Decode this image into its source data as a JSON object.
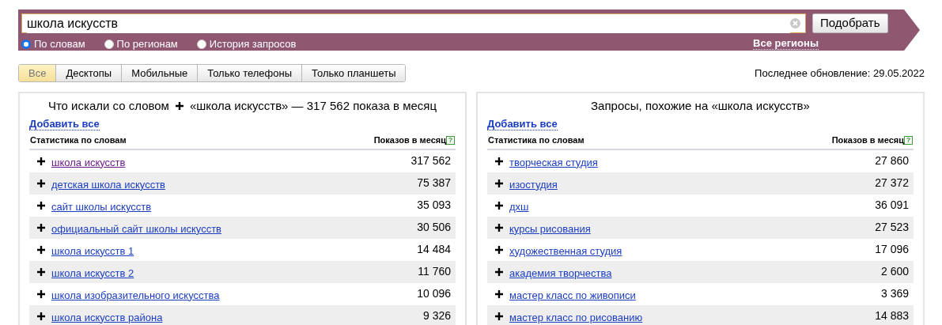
{
  "search": {
    "value": "школа искусств",
    "button": "Подобрать",
    "modes": [
      {
        "label": "По словам",
        "selected": true
      },
      {
        "label": "По регионам",
        "selected": false
      },
      {
        "label": "История запросов",
        "selected": false
      }
    ],
    "regions_link": "Все регионы"
  },
  "device_tabs": [
    {
      "label": "Все",
      "selected": true
    },
    {
      "label": "Десктопы",
      "selected": false
    },
    {
      "label": "Мобильные",
      "selected": false
    },
    {
      "label": "Только телефоны",
      "selected": false
    },
    {
      "label": "Только планшеты",
      "selected": false
    }
  ],
  "last_update": "Последнее обновление: 29.05.2022",
  "panels": [
    {
      "title_prefix": "Что искали со словом",
      "title": "«школа искусств» — 317 562 показа в месяц",
      "add_all": "Добавить все",
      "col_phrase": "Статистика по словам",
      "col_count": "Показов в месяц",
      "help_mark": "?",
      "rows": [
        {
          "phrase": "школа искусств",
          "count": "317 562",
          "visited": true
        },
        {
          "phrase": "детская школа искусств",
          "count": "75 387",
          "visited": false
        },
        {
          "phrase": "сайт школы искусств",
          "count": "35 093",
          "visited": false
        },
        {
          "phrase": "официальный сайт школы искусств",
          "count": "30 506",
          "visited": false
        },
        {
          "phrase": "школа искусств 1",
          "count": "14 484",
          "visited": false
        },
        {
          "phrase": "школа искусств 2",
          "count": "11 760",
          "visited": false
        },
        {
          "phrase": "школа изобразительного искусства",
          "count": "10 096",
          "visited": false
        },
        {
          "phrase": "школа искусств района",
          "count": "9 326",
          "visited": false
        }
      ]
    },
    {
      "title": "Запросы, похожие на «школа искусств»",
      "add_all": "Добавить все",
      "col_phrase": "Статистика по словам",
      "col_count": "Показов в месяц",
      "help_mark": "?",
      "rows": [
        {
          "phrase": "творческая студия",
          "count": "27 860",
          "visited": false
        },
        {
          "phrase": "изостудия",
          "count": "27 372",
          "visited": false
        },
        {
          "phrase": "дхш",
          "count": "36 091",
          "visited": false
        },
        {
          "phrase": "курсы рисования",
          "count": "27 523",
          "visited": false
        },
        {
          "phrase": "художественная студия",
          "count": "17 096",
          "visited": false
        },
        {
          "phrase": "академия творчества",
          "count": "2 600",
          "visited": false
        },
        {
          "phrase": "мастер класс по живописи",
          "count": "3 369",
          "visited": false
        },
        {
          "phrase": "мастер класс по рисованию",
          "count": "14 883",
          "visited": false
        }
      ]
    }
  ]
}
